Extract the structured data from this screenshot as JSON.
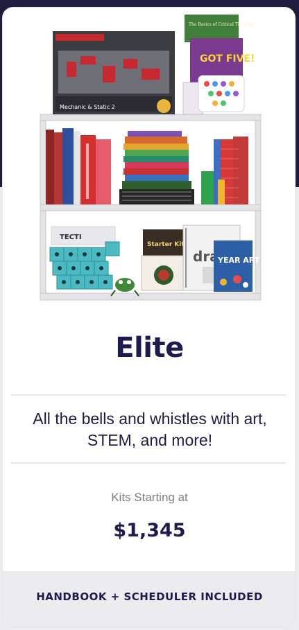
{
  "plan": {
    "name": "Elite",
    "description": "All the bells and whistles with art, STEM, and more!",
    "price_label": "Kits Starting at",
    "price": "$1,345",
    "footer_note": "HANDBOOK + SCHEDULER INCLUDED"
  },
  "image": {
    "box_top_left_title": "Mechanic & Static 2",
    "box_top_right_title": "GOT FIVE!",
    "box_top_right_header": "The Basics of Critical Thinking",
    "box_blocks_label": "TECTI",
    "book_starter_kit": "Starter Kit",
    "book_drawing": "draw",
    "book_year_art": "YEAR ART"
  },
  "colors": {
    "backdrop_top": "#1f1d3f",
    "backdrop_bottom": "#ececee",
    "brand_navy": "#1d1b4f",
    "muted_text": "#7d7d8a"
  }
}
